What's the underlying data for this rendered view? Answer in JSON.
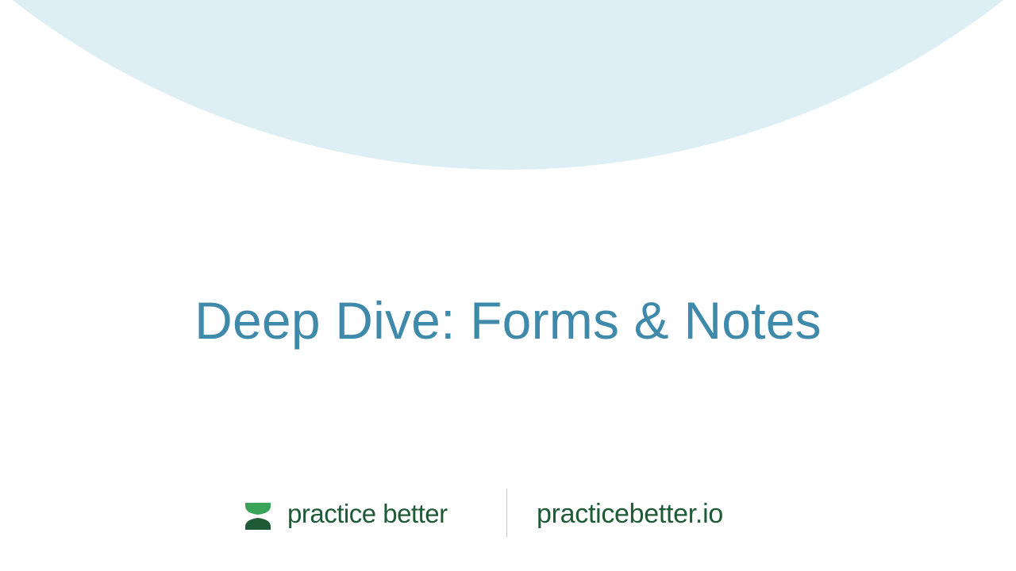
{
  "slide": {
    "title": "Deep Dive: Forms & Notes"
  },
  "footer": {
    "brand_name": "practice better",
    "website": "practicebetter.io"
  },
  "colors": {
    "background": "#ffffff",
    "arc": "#ddeff5",
    "title": "#3f8aab",
    "brand_dark_green": "#1f5a37",
    "brand_light_green": "#3aa35a",
    "divider": "#c9c9c9"
  },
  "icons": {
    "logo": "practice-better-logo-icon"
  }
}
